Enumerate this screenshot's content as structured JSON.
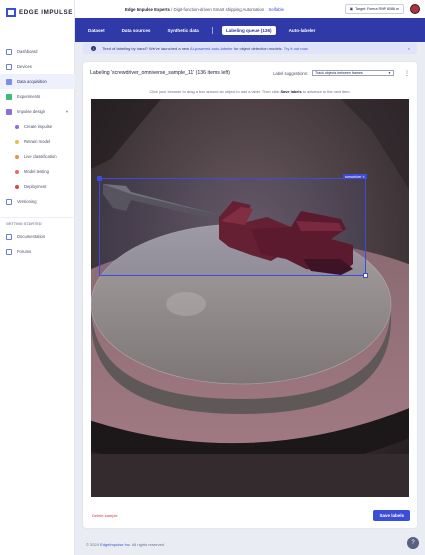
{
  "app": {
    "logo_text": "EDGE IMPULSE"
  },
  "sidebar": {
    "items": [
      {
        "label": "Dashboard",
        "icon": "dashboard-icon"
      },
      {
        "label": "Devices",
        "icon": "devices-icon"
      },
      {
        "label": "Data acquisition",
        "icon": "data-acquisition-icon",
        "active": true
      },
      {
        "label": "Experiments",
        "icon": "experiments-icon"
      },
      {
        "label": "Impulse design",
        "icon": "impulse-design-icon",
        "expandable": true
      }
    ],
    "subitems": [
      {
        "label": "Create impulse",
        "color": "#8d6ee0"
      },
      {
        "label": "Retrain model",
        "color": "#e2c04a"
      },
      {
        "label": "Live classification",
        "color": "#e0973a"
      },
      {
        "label": "Model testing",
        "color": "#e06c5a"
      },
      {
        "label": "Deployment",
        "color": "#d64a4a"
      }
    ],
    "versioning_label": "Versioning",
    "section_title": "GETTING STARTED",
    "getting_started": [
      {
        "label": "Documentation"
      },
      {
        "label": "Forums"
      }
    ]
  },
  "header": {
    "org": "Edge Impulse Experts",
    "separator": "/",
    "project": "Digit-function-driven Smart shipping Automation",
    "badge": "Selfable",
    "target_button": "Target: Fomra RNP 8086 m"
  },
  "tabs": [
    {
      "label": "Dataset",
      "active": false
    },
    {
      "label": "Data sources",
      "active": false
    },
    {
      "label": "Synthetic data",
      "active": false
    },
    {
      "label": "Labeling queue (136)",
      "active": true
    },
    {
      "label": "Auto-labeler",
      "active": false
    }
  ],
  "banner": {
    "text": "Tired of labeling by hand? We've launched a new ",
    "link": "AI-powered auto-labeler",
    "text2": " for object detection models. ",
    "cta": "Try it out now.",
    "close": "×"
  },
  "labeling": {
    "title": "Labeling 'screwdriver_omniverse_sample_11' (136 items left)",
    "suggestions_label": "Label suggestions:",
    "suggestions_value": "Track objects between frames",
    "hint_pre": "Click your browser to drag a box around an object to add a label. Then click ",
    "hint_bold": "Save labels",
    "hint_post": " to advance to the next item.",
    "box_label": "screwdriver",
    "delete_label": "Delete sample",
    "save_label": "Save labels"
  },
  "footer": {
    "copyright_pre": "© 2024 ",
    "brand": "EdgeImpulse Inc.",
    "copyright_post": " All rights reserved"
  },
  "colors": {
    "accent": "#3b4fd6",
    "tabbar": "#2f3aa8",
    "bbox": "#3c4bd8"
  }
}
